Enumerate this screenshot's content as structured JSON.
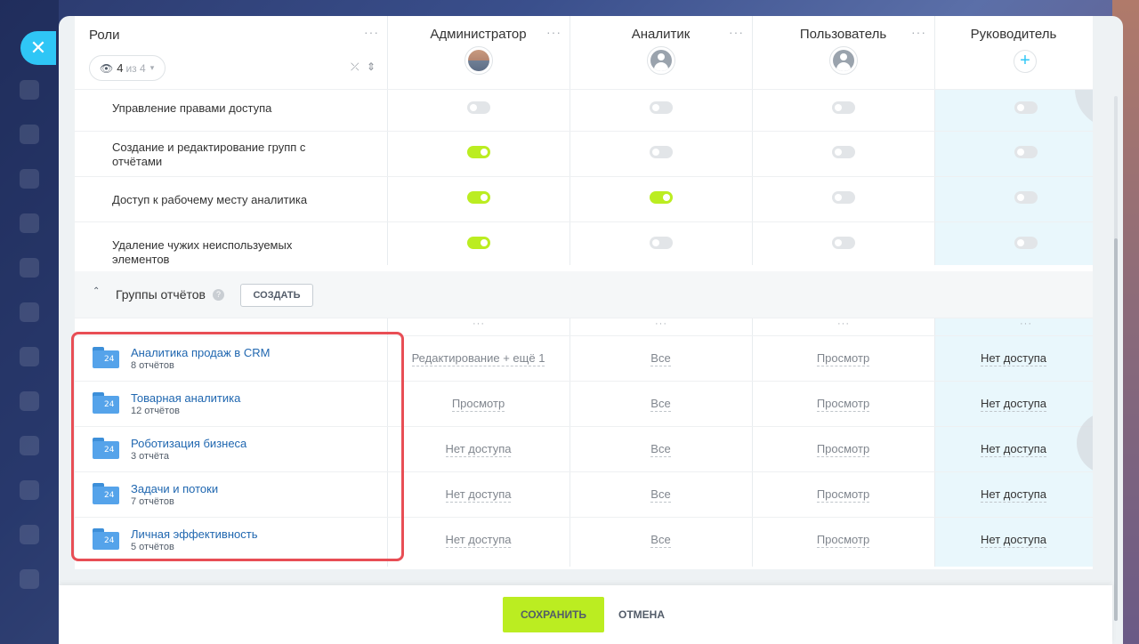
{
  "header": {
    "roles_label": "Роли",
    "filter": {
      "count": "4",
      "of": "из 4"
    },
    "columns": [
      {
        "name": "Администратор",
        "avatar": "photo"
      },
      {
        "name": "Аналитик",
        "avatar": "user-icon"
      },
      {
        "name": "Пользователь",
        "avatar": "user-icon"
      },
      {
        "name": "Руководитель",
        "avatar": "add-icon"
      }
    ]
  },
  "permissions": [
    {
      "label": "Управление правами доступа",
      "values": [
        false,
        false,
        false,
        false
      ]
    },
    {
      "label": "Создание и редактирование групп с отчётами",
      "values": [
        true,
        false,
        false,
        false
      ]
    },
    {
      "label": "Доступ к рабочему месту аналитика",
      "values": [
        true,
        true,
        false,
        false
      ]
    },
    {
      "label": "Удаление чужих неиспользуемых элементов",
      "values": [
        true,
        false,
        false,
        false
      ]
    }
  ],
  "groups": {
    "title": "Группы отчётов",
    "create_label": "СОЗДАТЬ",
    "folder_badge": "24",
    "items": [
      {
        "name": "Аналитика продаж в CRM",
        "count": "8 отчётов",
        "access": [
          "Редактирование + ещё 1",
          "Все",
          "Просмотр",
          "Нет доступа"
        ]
      },
      {
        "name": "Товарная аналитика",
        "count": "12 отчётов",
        "access": [
          "Просмотр",
          "Все",
          "Просмотр",
          "Нет доступа"
        ]
      },
      {
        "name": "Роботизация бизнеса",
        "count": "3 отчёта",
        "access": [
          "Нет доступа",
          "Все",
          "Просмотр",
          "Нет доступа"
        ]
      },
      {
        "name": "Задачи и потоки",
        "count": "7 отчётов",
        "access": [
          "Нет доступа",
          "Все",
          "Просмотр",
          "Нет доступа"
        ]
      },
      {
        "name": "Личная эффективность",
        "count": "5 отчётов",
        "access": [
          "Нет доступа",
          "Все",
          "Просмотр",
          "Нет доступа"
        ]
      }
    ]
  },
  "footer": {
    "save_label": "СОХРАНИТЬ",
    "cancel_label": "ОТМЕНА"
  },
  "colors": {
    "accent_green": "#bbed21",
    "link_blue": "#2067b0",
    "highlight_frame": "#e84e55",
    "highlight_column": "#e9f7fc"
  }
}
